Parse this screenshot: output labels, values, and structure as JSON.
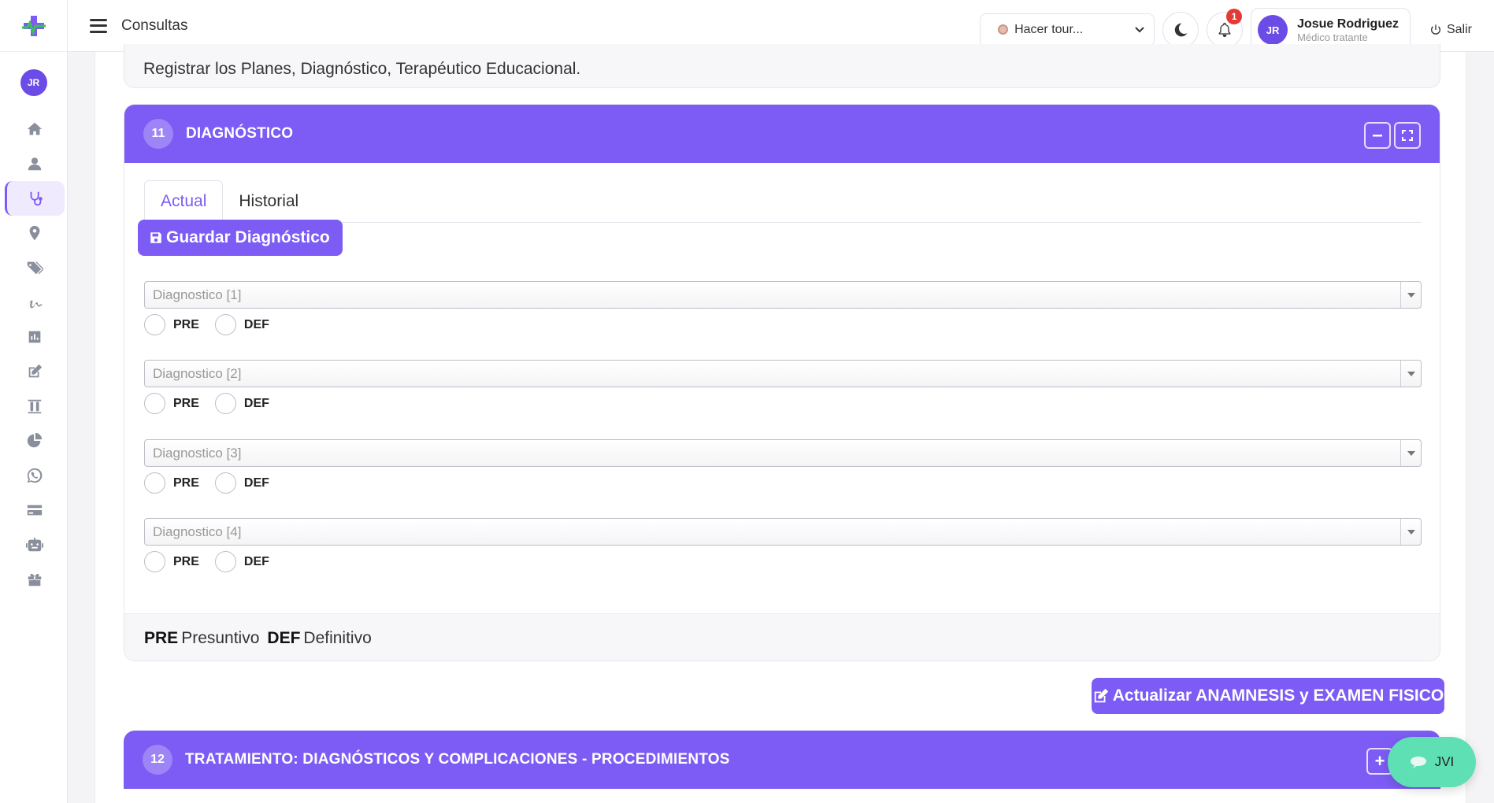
{
  "app": {
    "page_title": "Consultas",
    "accent_color": "#7c5cf4"
  },
  "topbar": {
    "tour_label": "Hacer tour...",
    "notification_count": "1",
    "user": {
      "initials": "JR",
      "name": "Josue Rodriguez",
      "role": "Médico tratante"
    },
    "logout_label": "Salir"
  },
  "sidebar": {
    "avatar_initials": "JR",
    "items": [
      {
        "icon": "home-icon"
      },
      {
        "icon": "user-icon"
      },
      {
        "icon": "stethoscope-icon",
        "active": true
      },
      {
        "icon": "map-pin-icon"
      },
      {
        "icon": "tags-icon"
      },
      {
        "icon": "signature-icon"
      },
      {
        "icon": "chart-icon"
      },
      {
        "icon": "edit-icon"
      },
      {
        "icon": "test-tubes-icon"
      },
      {
        "icon": "pie-chart-icon"
      },
      {
        "icon": "whatsapp-icon"
      },
      {
        "icon": "credit-card-icon"
      },
      {
        "icon": "robot-icon"
      },
      {
        "icon": "gift-icon"
      }
    ]
  },
  "previous_section": {
    "text": "Registrar los Planes, Diagnóstico, Terapéutico Educacional."
  },
  "diagnostico": {
    "number": "11",
    "title": "DIAGNÓSTICO",
    "tabs": [
      "Actual",
      "Historial"
    ],
    "save_label": "Guardar Diagnóstico",
    "fields": [
      {
        "placeholder": "Diagnostico [1]"
      },
      {
        "placeholder": "Diagnostico [2]"
      },
      {
        "placeholder": "Diagnostico [3]"
      },
      {
        "placeholder": "Diagnostico [4]"
      }
    ],
    "radio_labels": {
      "pre": "PRE",
      "def": "DEF"
    },
    "legend": {
      "pre_abbr": "PRE",
      "pre_text": "Presuntivo",
      "def_abbr": "DEF",
      "def_text": "Definitivo"
    }
  },
  "update_button_label": "Actualizar ANAMNESIS y EXAMEN FISICO",
  "tratamiento": {
    "number": "12",
    "title": "TRATAMIENTO: DIAGNÓSTICOS Y COMPLICACIONES - PROCEDIMIENTOS",
    "expand_label": "+"
  },
  "chat": {
    "label": "JVI"
  }
}
